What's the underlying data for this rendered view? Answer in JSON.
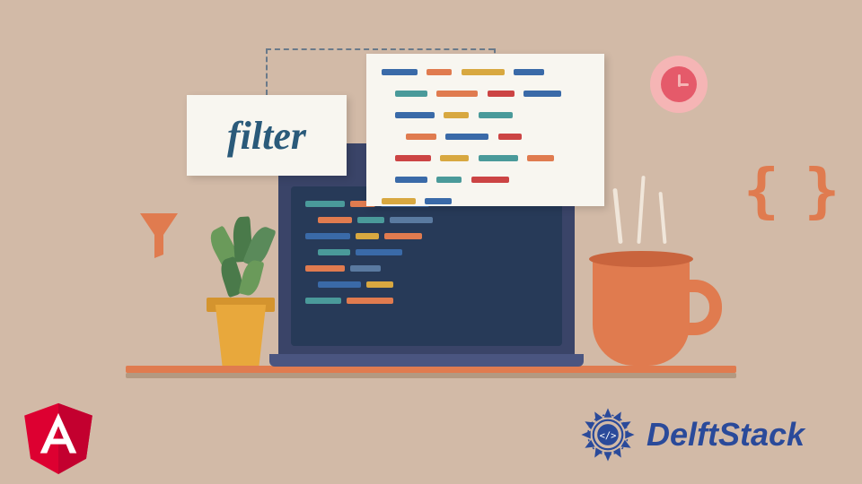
{
  "filter_label": "filter",
  "braces_glyph": "{ }",
  "brand": "DelftStack",
  "icons": {
    "angular": "angular-logo-icon",
    "delft": "delft-mandala-icon",
    "funnel": "funnel-icon",
    "clock": "clock-icon",
    "braces": "braces-icon",
    "mug": "coffee-mug-icon",
    "plant": "plant-icon",
    "laptop": "laptop-icon"
  },
  "colors": {
    "bg": "#d2baa7",
    "accent": "#e07b4f",
    "navy": "#273a58",
    "card": "#f8f6f0",
    "angular_red": "#dd0031",
    "delft_blue": "#2a4a9a"
  },
  "code_tokens": {
    "blue": "#3a6aa8",
    "orange": "#e07b4f",
    "teal": "#4a9a9a",
    "red": "#c44",
    "yellow": "#d8a840",
    "gray": "#8a9aaa"
  }
}
